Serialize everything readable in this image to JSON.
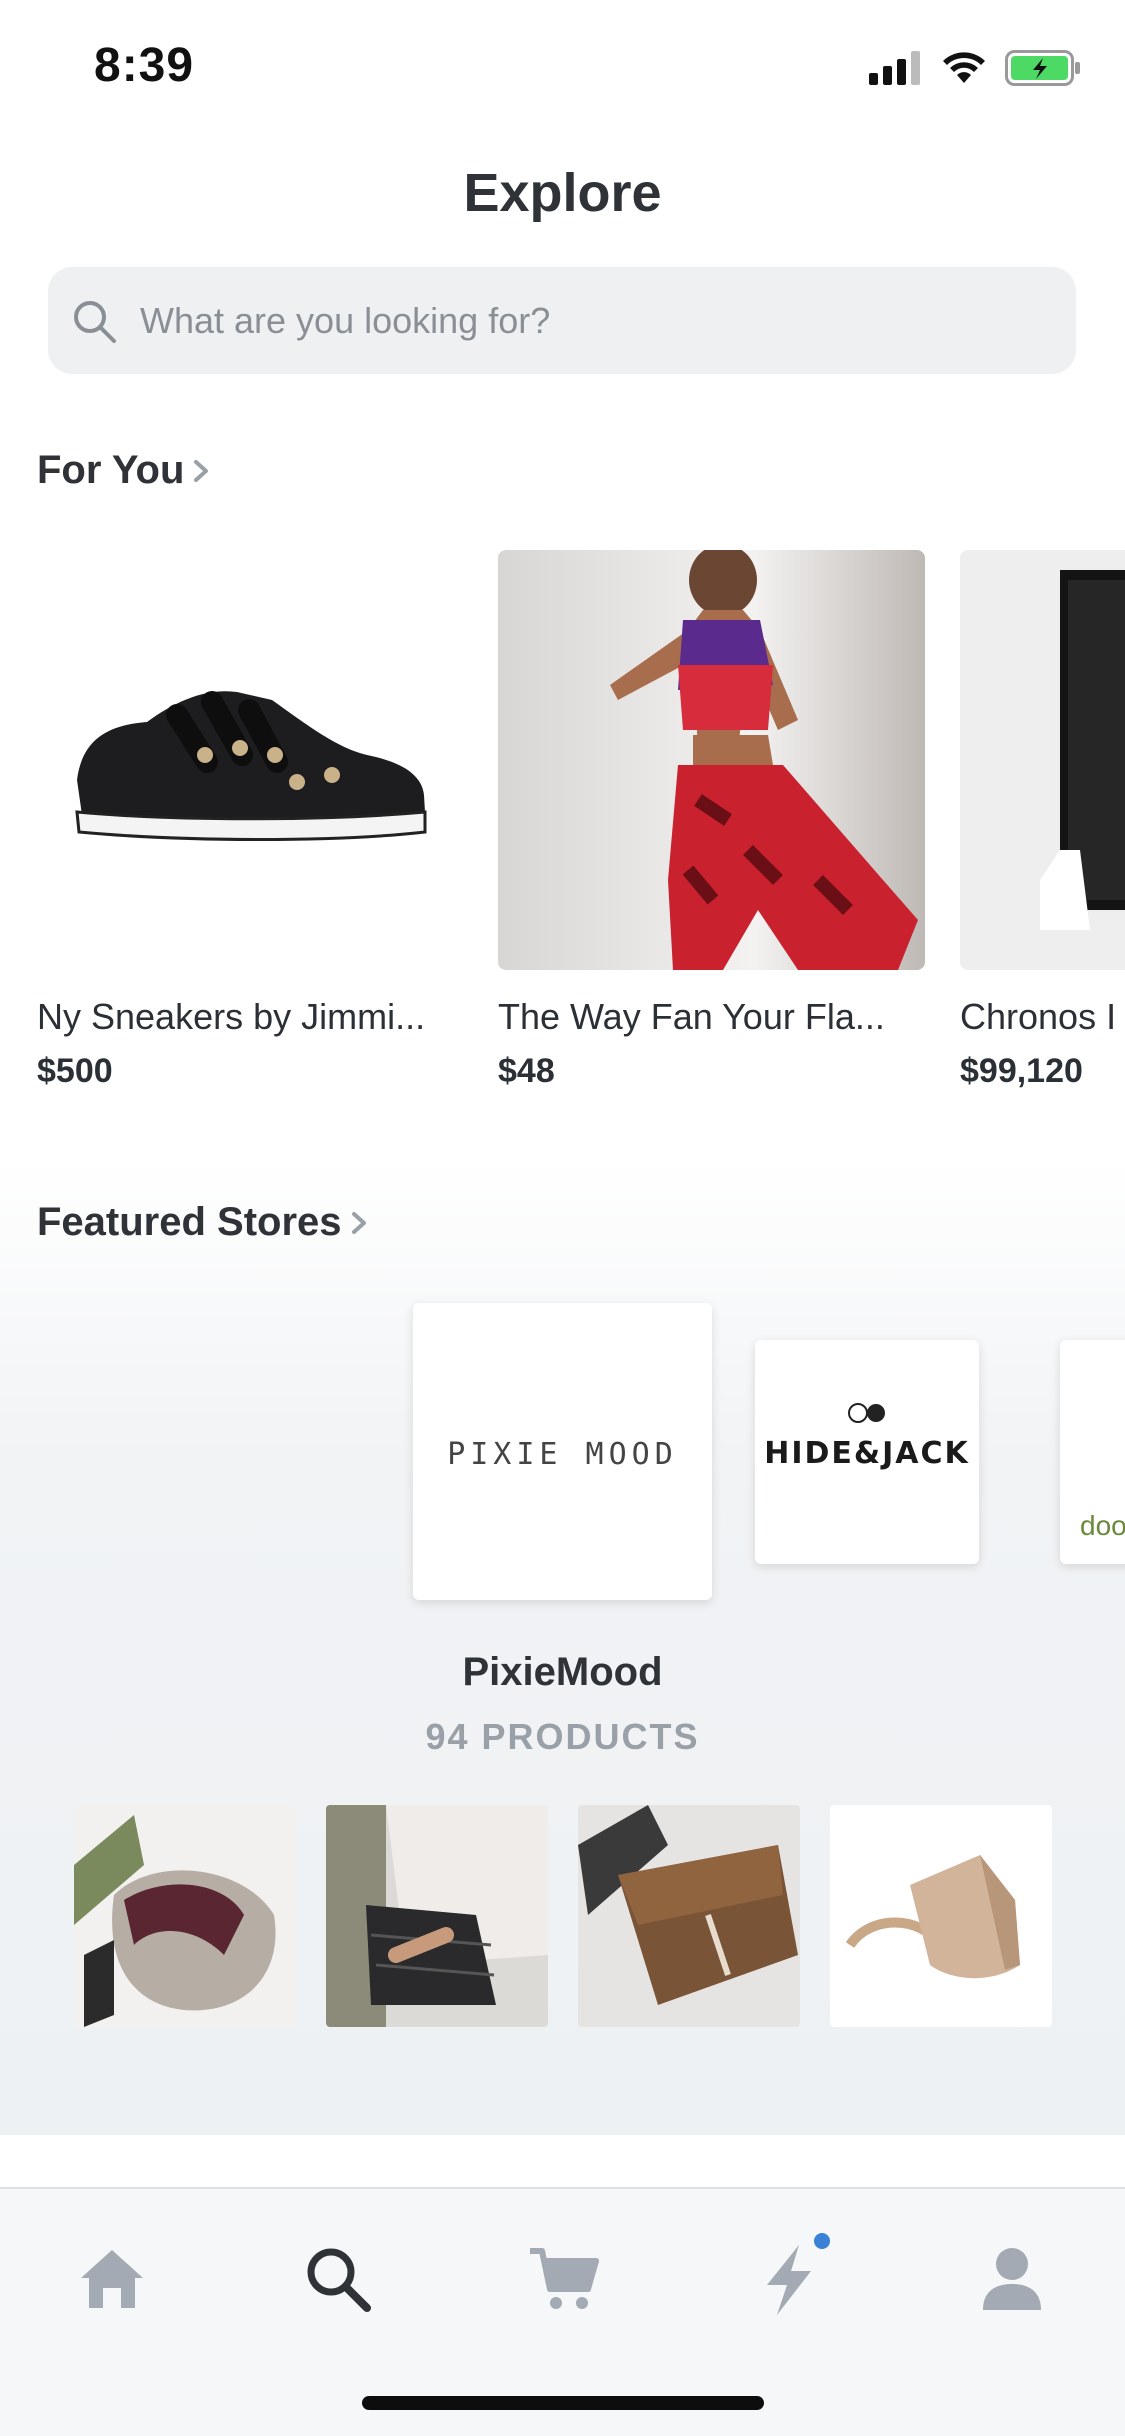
{
  "status_bar": {
    "time": "8:39"
  },
  "header": {
    "title": "Explore"
  },
  "search": {
    "placeholder": "What are you looking for?"
  },
  "for_you": {
    "title": "For You",
    "products": [
      {
        "name": "Ny Sneakers by Jimmi...",
        "price": "$500"
      },
      {
        "name": "The Way Fan Your Fla...",
        "price": "$48"
      },
      {
        "name": "Chronos I",
        "price": "$99,120"
      }
    ]
  },
  "featured_stores": {
    "title": "Featured Stores",
    "stores": [
      {
        "logo_text": "PIXIE MOOD"
      },
      {
        "logo_text": "HIDE&JACK"
      },
      {
        "logo_text": "doo"
      }
    ],
    "selected": {
      "name": "PixieMood",
      "count": "94 PRODUCTS"
    }
  },
  "tab_bar": {
    "tabs": [
      {
        "icon": "home-icon"
      },
      {
        "icon": "search-icon",
        "active": true
      },
      {
        "icon": "cart-icon"
      },
      {
        "icon": "lightning-icon",
        "badge": true
      },
      {
        "icon": "profile-icon"
      }
    ]
  },
  "colors": {
    "accent": "#2f3338",
    "inactive": "#a3aab3",
    "badge": "#3b82d6"
  }
}
